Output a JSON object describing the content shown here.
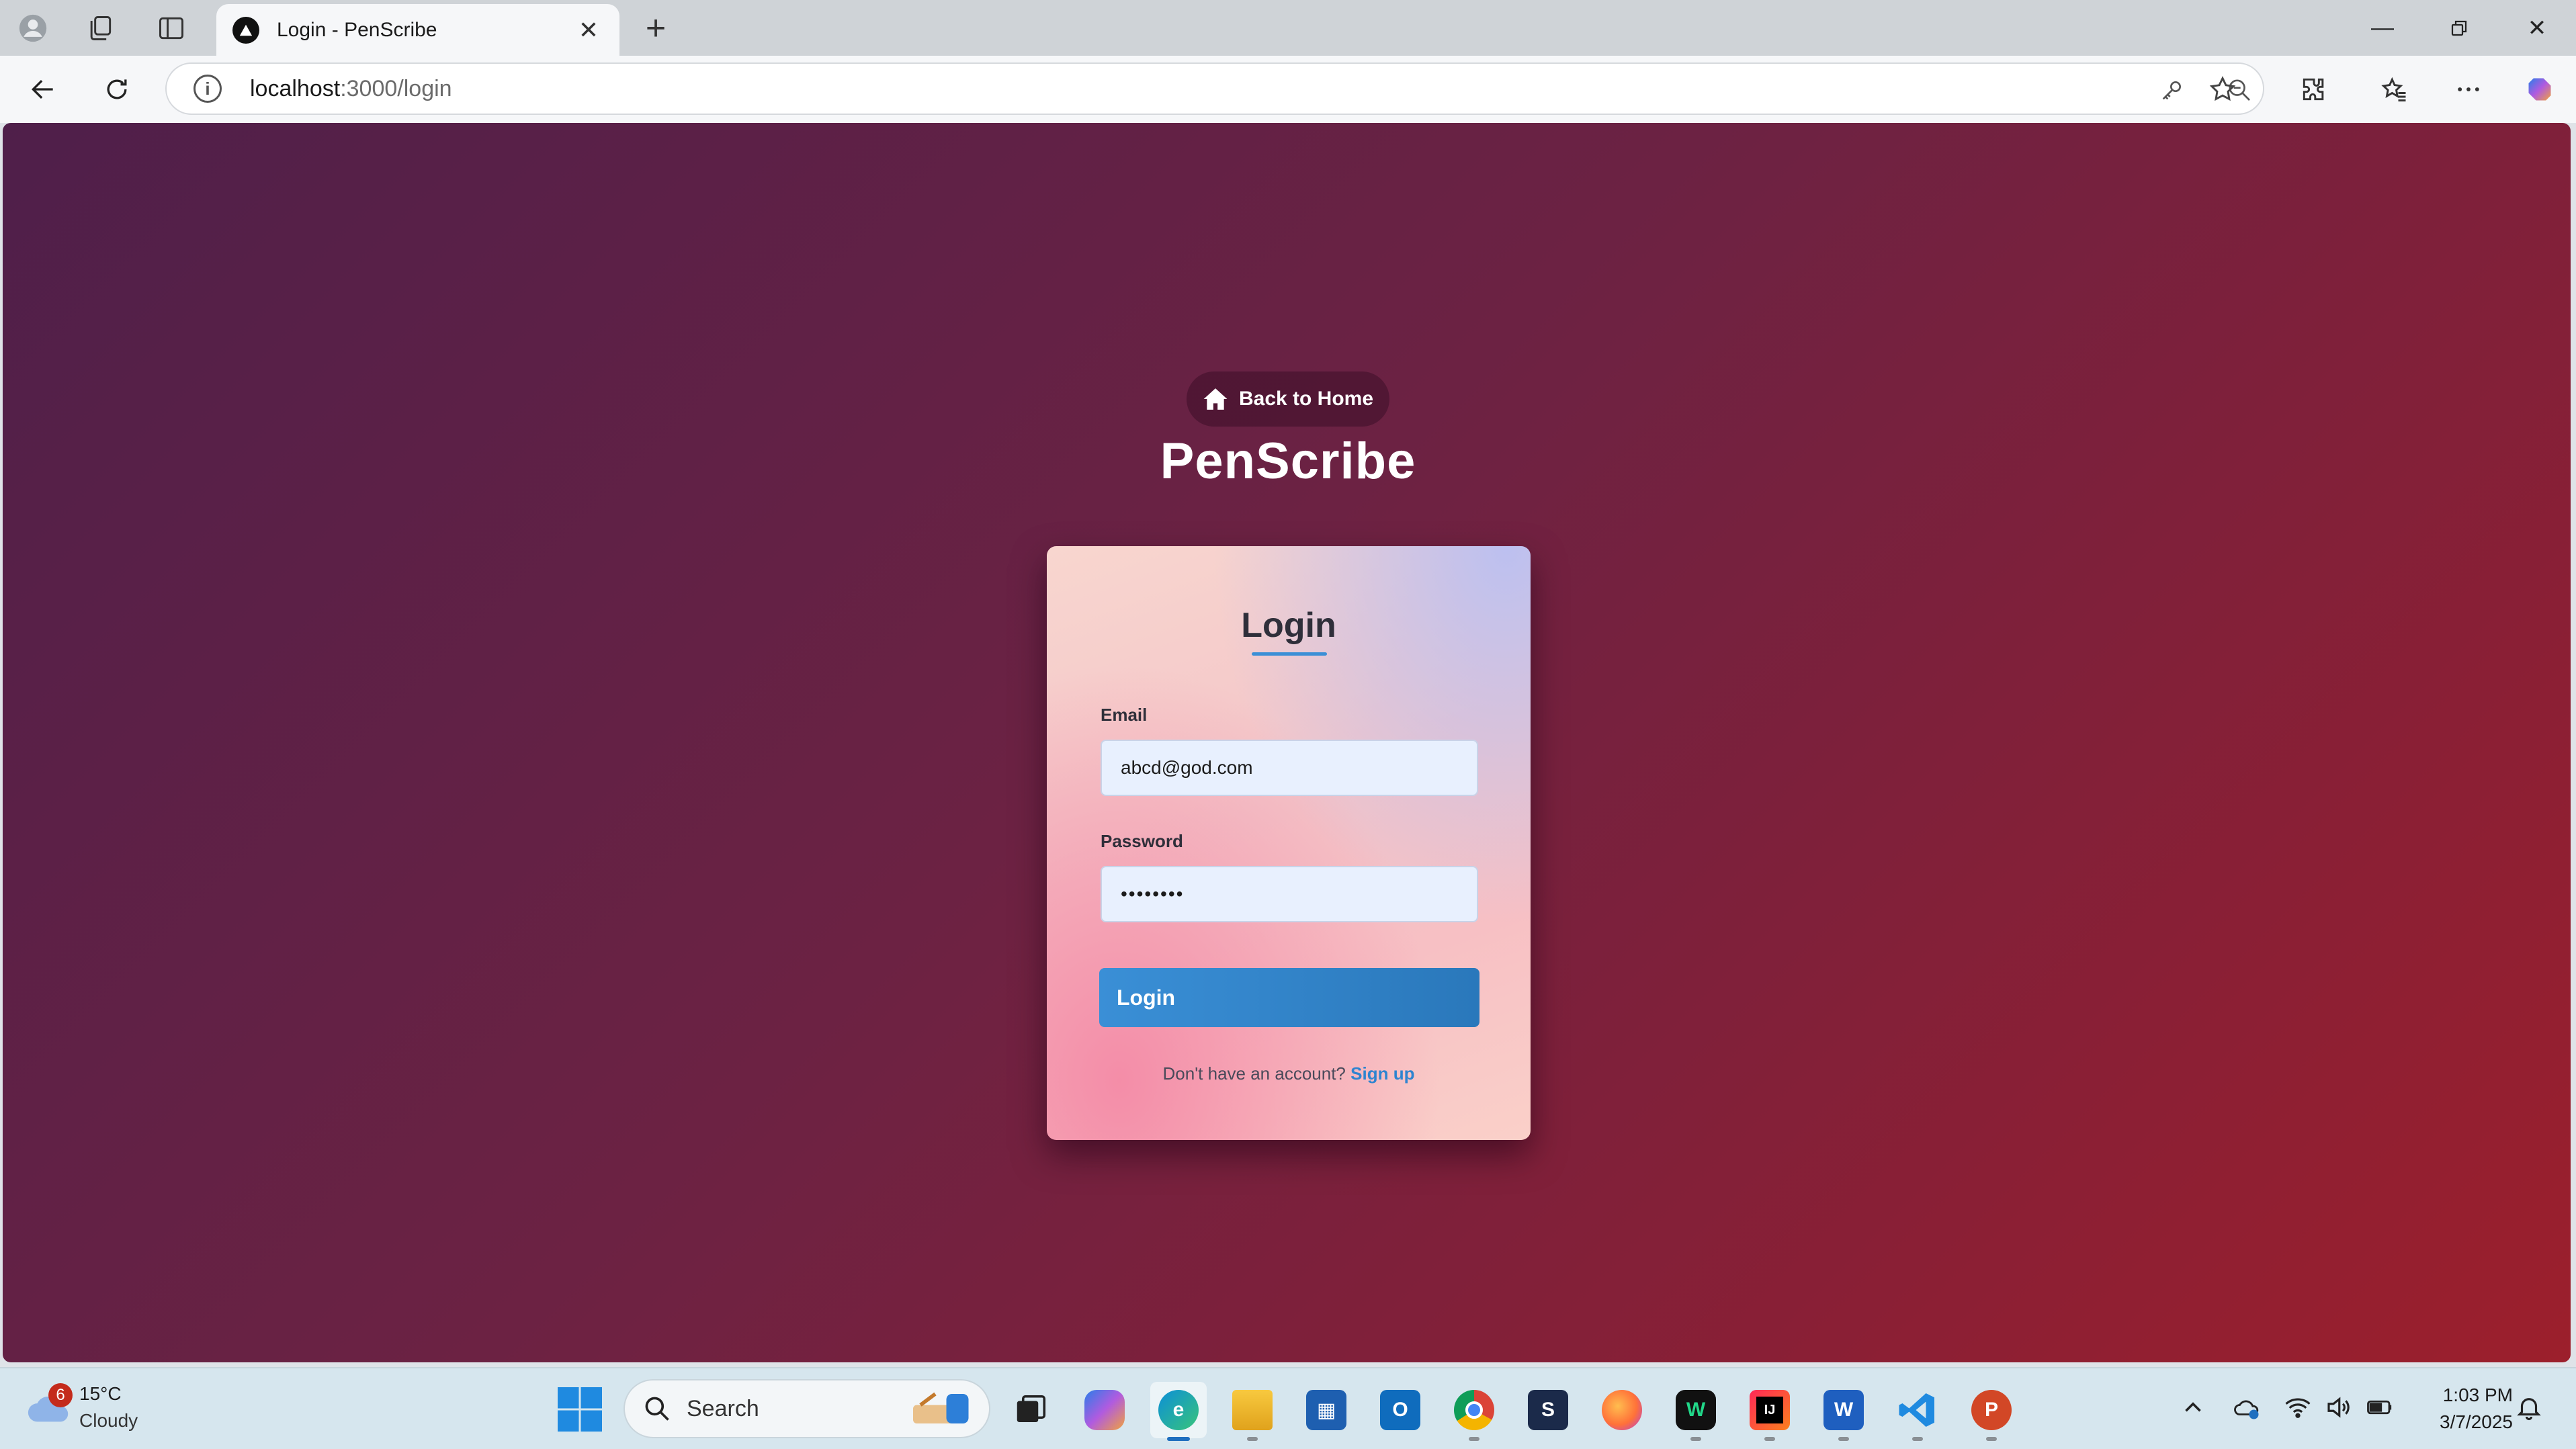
{
  "browser": {
    "tab_title": "Login - PenScribe",
    "url_host": "localhost",
    "url_path": ":3000/login"
  },
  "page": {
    "back_home_label": "Back to Home",
    "brand": "PenScribe",
    "card_title": "Login",
    "email_label": "Email",
    "email_value": "abcd@god.com",
    "password_label": "Password",
    "password_value": "••••••••",
    "login_button": "Login",
    "signup_prompt": "Don't have an account?",
    "signup_link": "Sign up",
    "colors": {
      "accent": "#3a8fd6",
      "link": "#2e84d0",
      "background_start": "#4f1f4a",
      "background_end": "#9c1f2c"
    }
  },
  "taskbar": {
    "weather_badge": "6",
    "weather_temp": "15°C",
    "weather_desc": "Cloudy",
    "search_label": "Search",
    "apps": [
      "task-view",
      "copilot",
      "edge",
      "file-explorer",
      "store",
      "outlook",
      "chrome",
      "app",
      "firefox",
      "webstorm",
      "intellij",
      "word",
      "vscode",
      "powerpoint"
    ],
    "time": "1:03 PM",
    "date": "3/7/2025"
  }
}
